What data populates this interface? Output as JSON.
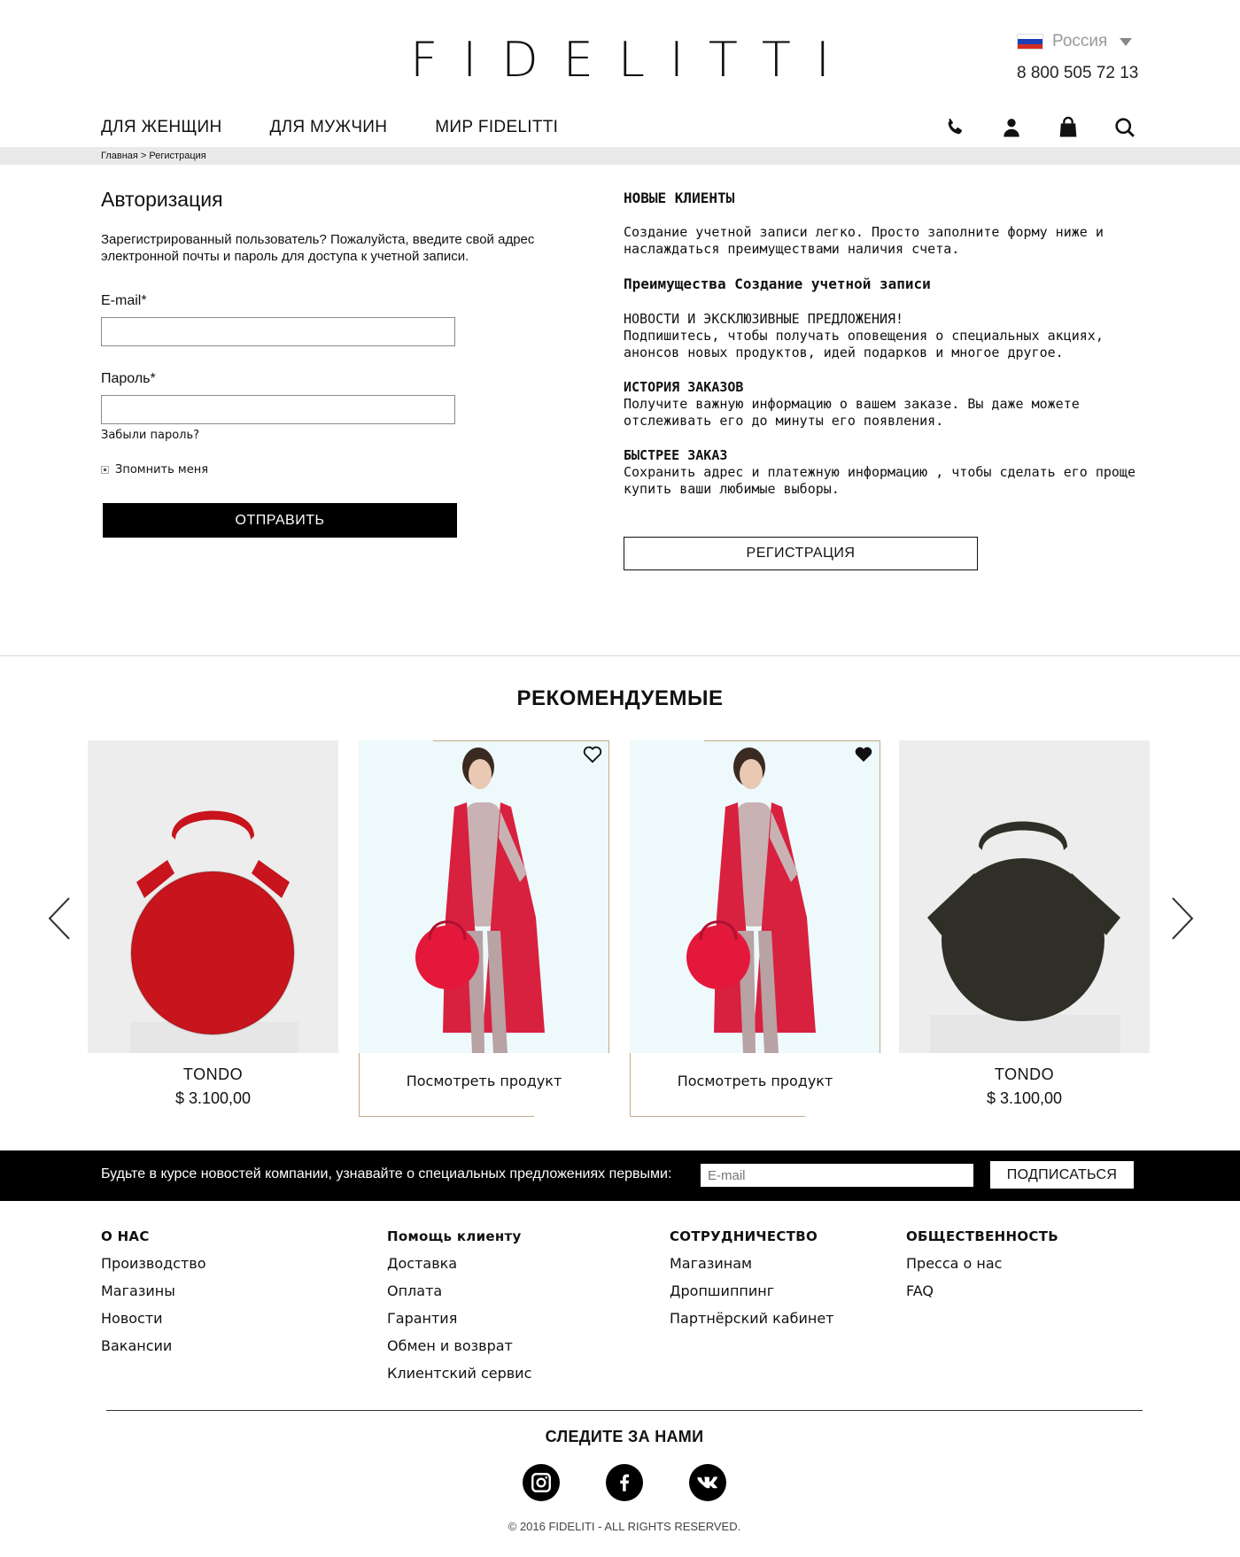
{
  "header": {
    "logo": "FIDELITTI",
    "country": "Россия",
    "phone": "8 800 505 72 13"
  },
  "nav": {
    "items": [
      "ДЛЯ ЖЕНЩИН",
      "ДЛЯ МУЖЧИН",
      "МИР FIDELITTI"
    ],
    "icons": [
      "phone-icon",
      "user-icon",
      "bag-icon",
      "search-icon"
    ]
  },
  "breadcrumb": {
    "home": "Главная",
    "separator": " > ",
    "current": "Регистрация"
  },
  "auth": {
    "title": "Авторизация",
    "description": "Зарегистрированный пользователь? Пожалуйста, введите свой адрес электронной почты и пароль для доступа к учетной записи.",
    "email_label": "E-mail*",
    "email_value": "",
    "password_label": "Пароль*",
    "password_value": "",
    "forgot": "Забыли пароль?",
    "remember": "Зпомнить меня",
    "submit": "ОТПРАВИТЬ"
  },
  "new_clients": {
    "title": "НОВЫЕ КЛИЕНТЫ",
    "intro": "Создание учетной записи легко. Просто заполните форму ниже и наслаждаться преимуществами наличия счета.",
    "benefits_title": "Преимущества Создание учетной записи",
    "news_title": "НОВОСТИ И ЭКСКЛЮЗИВНЫЕ ПРЕДЛОЖЕНИЯ!",
    "news_text": "Подпишитесь, чтобы получать оповещения о специальных акциях, анонсов новых продуктов, идей подарков и многое другое.",
    "history_title": "ИСТОРИЯ ЗАКАЗОВ",
    "history_text": "Получите важную информацию о вашем заказе. Вы даже можете отслеживать его до минуты его появления.",
    "fast_title": "БЫСТРЕЕ ЗАКАЗ",
    "fast_text": "Сохранить адрес и платежную информацию , чтобы сделать его проще купить ваши любимые выборы.",
    "register": "РЕГИСТРАЦИЯ"
  },
  "recommended": {
    "title": "РЕКОМЕНДУЕМЫЕ",
    "products": [
      {
        "type": "bag",
        "color": "#c8141c",
        "name": "TONDO",
        "price": "$ 3.100,00"
      },
      {
        "type": "model",
        "favorite": false,
        "view": "Посмотреть продукт"
      },
      {
        "type": "model",
        "favorite": true,
        "view": "Посмотреть продукт"
      },
      {
        "type": "bag",
        "color": "#2f2f27",
        "name": "TONDO",
        "price": "$ 3.100,00"
      }
    ]
  },
  "newsletter": {
    "text": "Будьте в курсе новостей компании, узнавайте о специальных предложениях первыми:",
    "placeholder": "E-mail",
    "button": "ПОДПИСАТЬСЯ"
  },
  "footer": {
    "about": {
      "title": "О НАС",
      "links": [
        "Производство",
        "Магазины",
        "Новости",
        "Вакансии"
      ]
    },
    "help": {
      "title": "Помощь клиенту",
      "links": [
        "Доставка",
        "Оплата",
        "Гарантия",
        "Обмен и возврат",
        "Клиентский сервис"
      ]
    },
    "partners": {
      "title": "СОТРУДНИЧЕСТВО",
      "links": [
        "Магазинам",
        "Дропшиппинг",
        "Партнёрский кабинет"
      ]
    },
    "public": {
      "title": "ОБЩЕСТВЕННОСТЬ",
      "links": [
        "Пресса о нас",
        "FAQ"
      ]
    },
    "follow": "СЛЕДИТЕ ЗА НАМИ",
    "social": [
      "instagram-icon",
      "facebook-icon",
      "vk-icon"
    ],
    "copyright": "© 2016 FIDELITI - ALL RIGHTS RESERVED."
  }
}
